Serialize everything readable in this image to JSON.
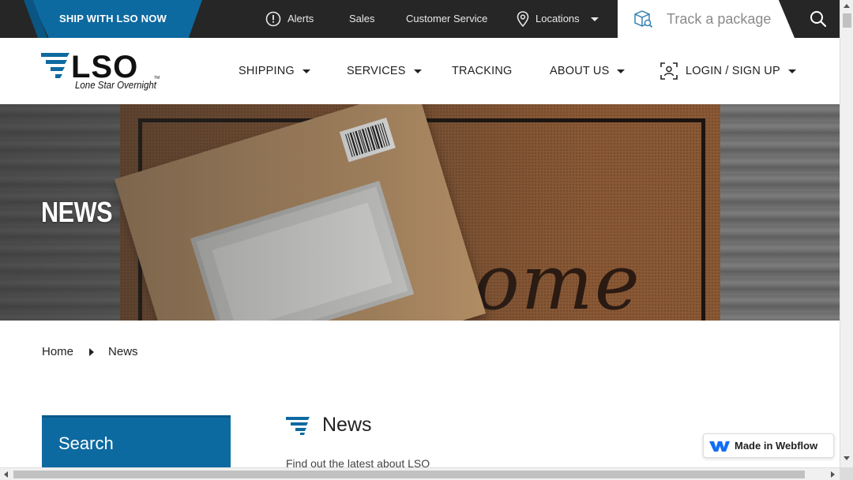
{
  "topbar": {
    "ship_cta": "SHIP WITH LSO NOW",
    "alerts": "Alerts",
    "sales": "Sales",
    "customer_service": "Customer Service",
    "locations": "Locations",
    "track_placeholder": "Track a package",
    "icons": {
      "alerts": "exclamation-circle-icon",
      "locations": "map-pin-icon",
      "track": "package-box-icon",
      "search": "search-icon"
    }
  },
  "brand": {
    "logo_text": "LSO",
    "tagline": "Lone Star Overnight",
    "trademark": "TM"
  },
  "nav": {
    "shipping": "SHIPPING",
    "services": "SERVICES",
    "tracking": "TRACKING",
    "about": "ABOUT US",
    "login": "LOGIN / SIGN UP"
  },
  "hero": {
    "title": "NEWS",
    "mat_text": "ome"
  },
  "breadcrumb": {
    "home": "Home",
    "current": "News"
  },
  "sidebar": {
    "search_title": "Search"
  },
  "content": {
    "title": "News",
    "subtitle": "Find out the latest about LSO"
  },
  "badge": {
    "label": "Made in Webflow"
  },
  "colors": {
    "brand_blue": "#0d6aa0",
    "topbar_bg": "#262626"
  }
}
